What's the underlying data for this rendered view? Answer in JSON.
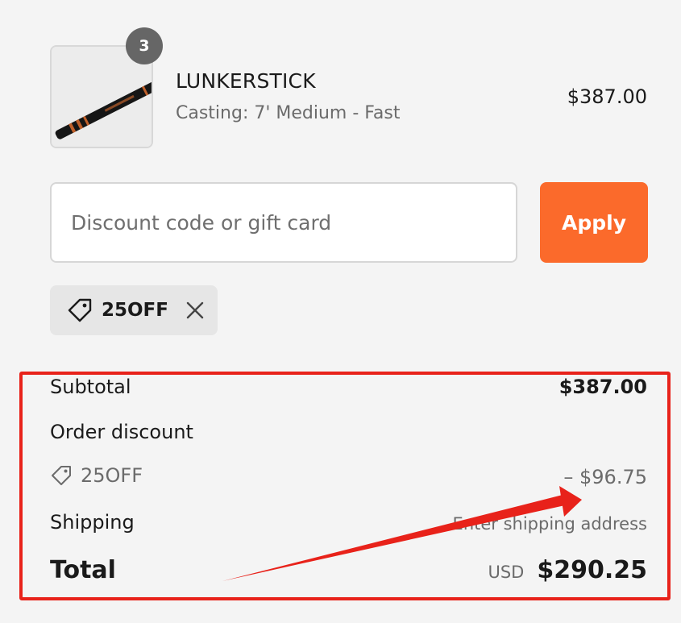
{
  "product": {
    "quantity": "3",
    "name": "LUNKERSTICK",
    "variant": "Casting: 7' Medium - Fast",
    "price": "$387.00",
    "image_icon": "fishing-rod-image"
  },
  "discount": {
    "placeholder": "Discount code or gift card",
    "value": "",
    "apply_label": "Apply"
  },
  "applied_code": {
    "code": "25OFF",
    "icon": "tag-icon",
    "remove_icon": "close-icon"
  },
  "summary": {
    "subtotal_label": "Subtotal",
    "subtotal_value": "$387.00",
    "order_discount_label": "Order discount",
    "discount_code": "25OFF",
    "discount_amount": "– $96.75",
    "shipping_label": "Shipping",
    "shipping_value": "Enter shipping address",
    "total_label": "Total",
    "currency": "USD",
    "total_value": "$290.25"
  },
  "colors": {
    "background": "#f4f4f4",
    "accent": "#fb6a2b",
    "annotation": "#e8221a",
    "badge": "#666666"
  }
}
